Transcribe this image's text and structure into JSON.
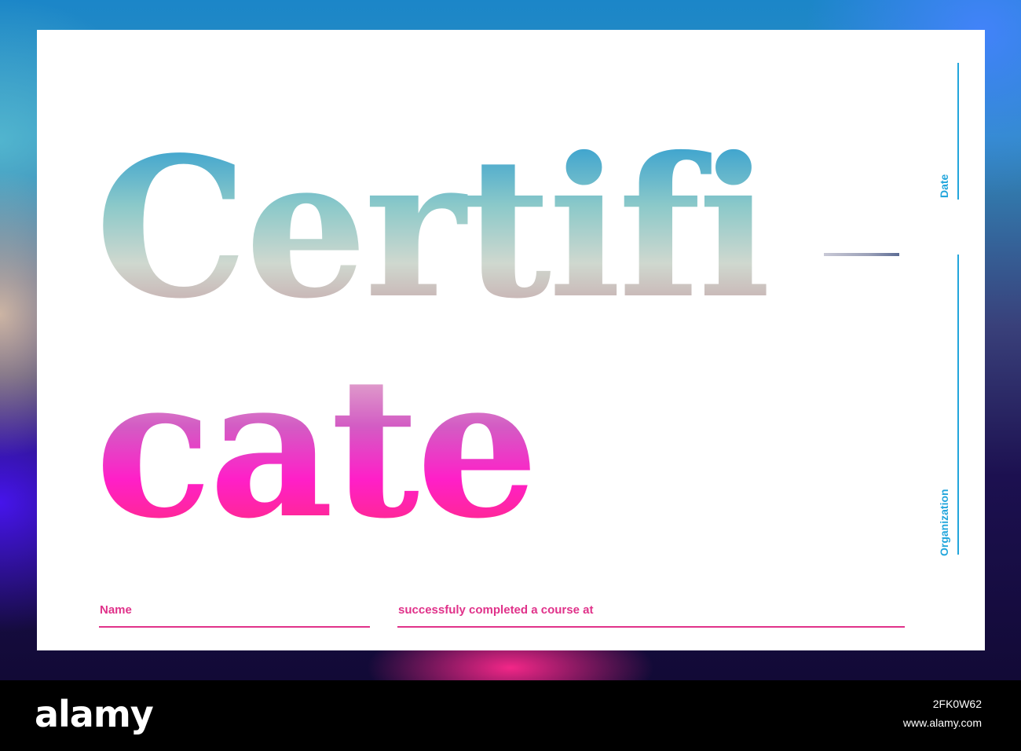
{
  "certificate": {
    "title_line1": "Certifi",
    "title_hyphen": "-",
    "title_line2": "cate",
    "date_label": "Date",
    "organization_label": "Organization",
    "name_label": "Name",
    "course_label": "successfuly completed a course at"
  },
  "watermark": {
    "logo": "alamy",
    "image_id": "2FK0W62",
    "site": "www.alamy.com"
  },
  "colors": {
    "accent_blue": "#22a6dc",
    "accent_pink": "#e0328a",
    "sheet": "#ffffff"
  }
}
